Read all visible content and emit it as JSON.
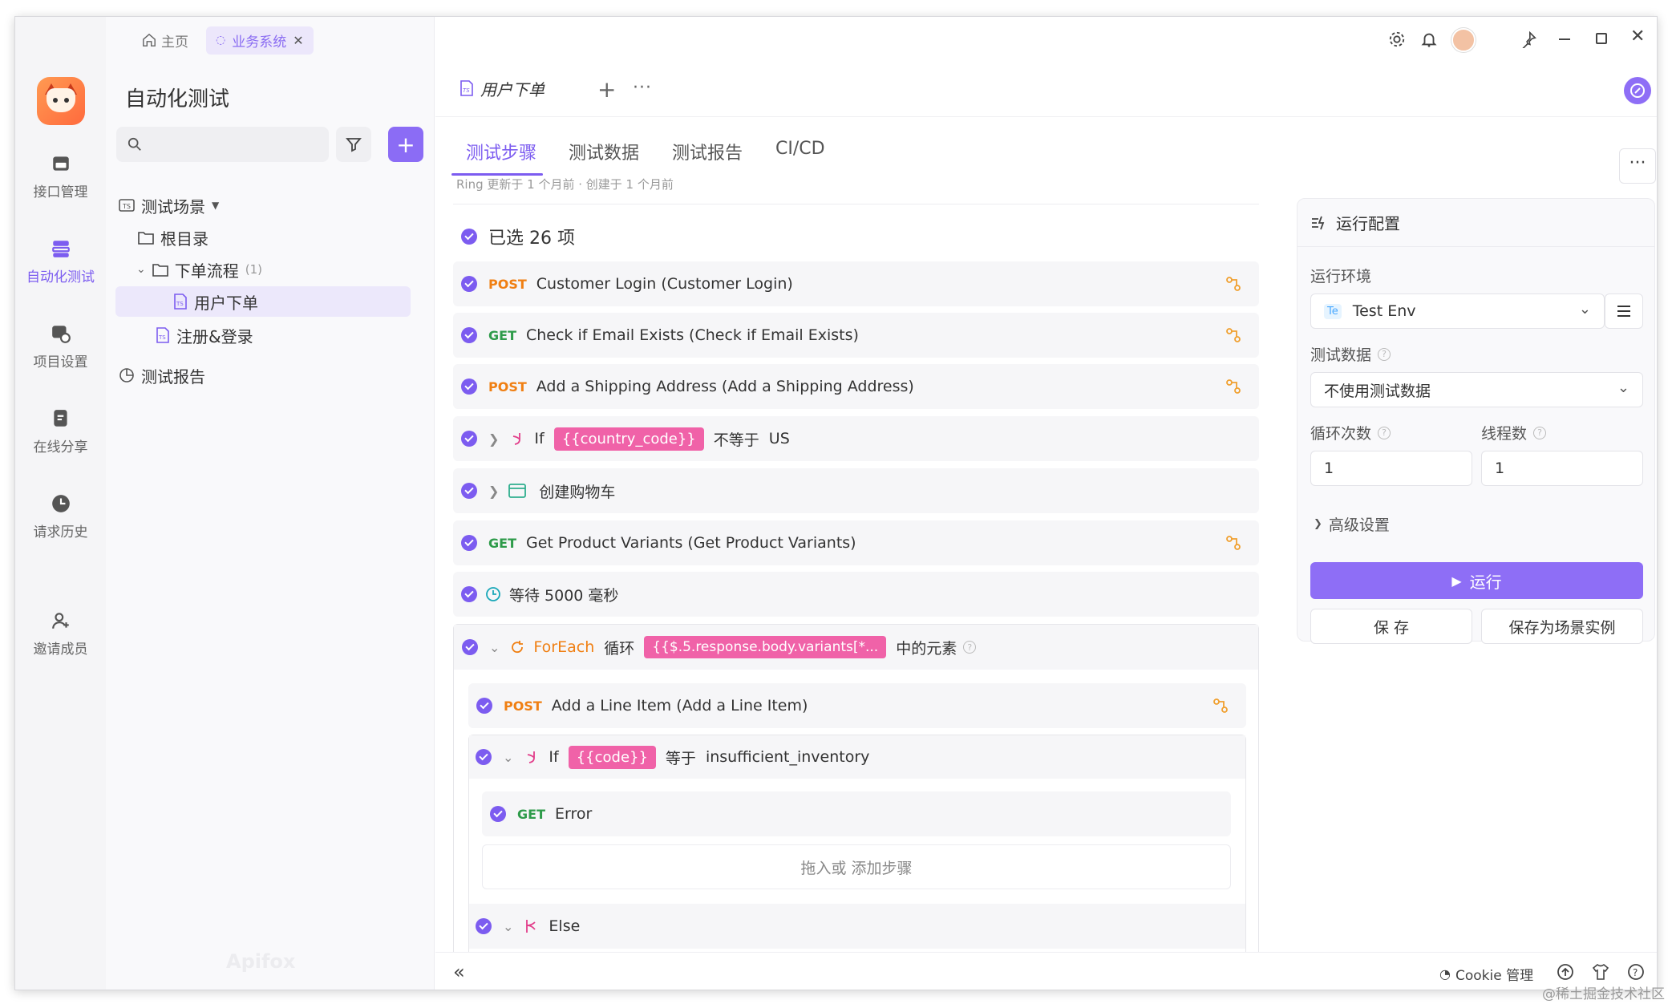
{
  "titlebar": {
    "home_label": "主页",
    "biz_tab_label": "业务系统"
  },
  "rail": {
    "items": [
      {
        "label": "接口管理"
      },
      {
        "label": "自动化测试"
      },
      {
        "label": "项目设置"
      },
      {
        "label": "在线分享"
      },
      {
        "label": "请求历史"
      },
      {
        "label": "邀请成员"
      }
    ]
  },
  "tree": {
    "title": "自动化测试",
    "nodes": [
      {
        "label": "测试场景"
      },
      {
        "label": "根目录"
      },
      {
        "label": "下单流程",
        "count": "(1)"
      },
      {
        "label": "用户下单"
      },
      {
        "label": "注册&登录"
      },
      {
        "label": "测试报告"
      }
    ]
  },
  "main": {
    "doc_tab": "用户下单",
    "subtabs": [
      "测试步骤",
      "测试数据",
      "测试报告",
      "CI/CD"
    ],
    "meta": "Ring 更新于 1 个月前 · 创建于 1 个月前",
    "selected": "已选 26 项",
    "steps": {
      "s1": {
        "method": "POST",
        "text": "Customer Login (Customer Login)"
      },
      "s2": {
        "method": "GET",
        "text": "Check if Email Exists (Check if Email Exists)"
      },
      "s3": {
        "method": "POST",
        "text": "Add a Shipping Address (Add a Shipping Address)"
      },
      "s4": {
        "kw": "If",
        "var": "{{country_code}}",
        "op": "不等于",
        "val": "US"
      },
      "s5": {
        "text": "创建购物车"
      },
      "s6": {
        "method": "GET",
        "text": "Get Product Variants (Get Product Variants)"
      },
      "s7": {
        "text": "等待 5000 毫秒"
      },
      "s8": {
        "kw": "ForEach",
        "loop": "循环",
        "var": "{{$.5.response.body.variants[*...",
        "suffix": "中的元素"
      },
      "s9": {
        "method": "POST",
        "text": "Add a Line Item (Add a Line Item)"
      },
      "s10": {
        "kw": "If",
        "var": "{{code}}",
        "op": "等于",
        "val": "insufficient_inventory"
      },
      "s11": {
        "method": "GET",
        "text": "Error"
      },
      "s12": {
        "text": "拖入或 添加步骤"
      },
      "s13": {
        "kw": "Else"
      }
    }
  },
  "config": {
    "title": "运行配置",
    "env_label": "运行环境",
    "env_badge": "Te",
    "env_value": "Test Env",
    "data_label": "测试数据",
    "data_value": "不使用测试数据",
    "loop_label": "循环次数",
    "loop_value": "1",
    "thread_label": "线程数",
    "thread_value": "1",
    "advanced": "高级设置",
    "run": "运行",
    "save": "保 存",
    "save_as": "保存为场景实例"
  },
  "bottom": {
    "cookie": "Cookie 管理",
    "watermark": "Apifox",
    "credit": "@稀土掘金技术社区"
  },
  "colors": {
    "accent": "#7c5cf0",
    "post": "#f07f12",
    "get": "#2e9b4a",
    "var_tag": "#f062a8"
  }
}
